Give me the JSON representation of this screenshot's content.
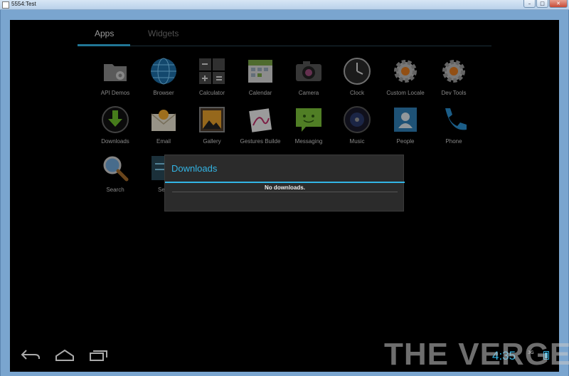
{
  "window": {
    "title": "5554:Test",
    "controls": [
      "–",
      "□",
      "✕"
    ]
  },
  "tabs": {
    "apps": "Apps",
    "widgets": "Widgets"
  },
  "apps": [
    {
      "label": "API Demos",
      "icon": "folder-gear-icon"
    },
    {
      "label": "Browser",
      "icon": "globe-icon"
    },
    {
      "label": "Calculator",
      "icon": "calculator-icon"
    },
    {
      "label": "Calendar",
      "icon": "calendar-icon"
    },
    {
      "label": "Camera",
      "icon": "camera-icon"
    },
    {
      "label": "Clock",
      "icon": "clock-icon"
    },
    {
      "label": "Custom Locale",
      "icon": "gear-icon"
    },
    {
      "label": "Dev Tools",
      "icon": "gear-icon"
    },
    {
      "label": "Downloads",
      "icon": "download-icon"
    },
    {
      "label": "Email",
      "icon": "email-icon"
    },
    {
      "label": "Gallery",
      "icon": "gallery-icon"
    },
    {
      "label": "Gestures Builde",
      "icon": "gesture-icon"
    },
    {
      "label": "Messaging",
      "icon": "message-icon"
    },
    {
      "label": "Music",
      "icon": "music-icon"
    },
    {
      "label": "People",
      "icon": "people-icon"
    },
    {
      "label": "Phone",
      "icon": "phone-icon"
    },
    {
      "label": "Search",
      "icon": "search-icon"
    },
    {
      "label": "Setti",
      "icon": "settings-icon"
    }
  ],
  "dialog": {
    "title": "Downloads",
    "message": "No downloads."
  },
  "status": {
    "time": "4:35",
    "network": "3G"
  },
  "watermark": "THE VERGE",
  "colors": {
    "accent": "#33b5e5",
    "screen_bg": "#000000",
    "dialog_bg": "#2b2b2b"
  }
}
